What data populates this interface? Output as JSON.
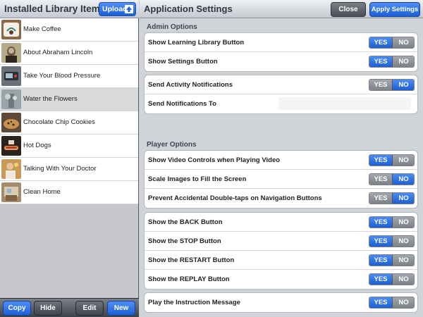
{
  "left_panel": {
    "title": "Installed Library Items",
    "upload_label": "Upload",
    "items": [
      {
        "label": "Make Coffee",
        "thumb": "coffee-thumbnail"
      },
      {
        "label": "About Abraham Lincoln",
        "thumb": "lincoln-portrait-thumbnail"
      },
      {
        "label": "Take Your Blood Pressure",
        "thumb": "blood-pressure-thumbnail"
      },
      {
        "label": "Water the Flowers",
        "thumb": "flowers-thumbnail",
        "selected": true
      },
      {
        "label": "Chocolate Chip Cookies",
        "thumb": "cookies-thumbnail"
      },
      {
        "label": "Hot Dogs",
        "thumb": "hot-dogs-thumbnail"
      },
      {
        "label": "Talking With Your Doctor",
        "thumb": "doctor-thumbnail"
      },
      {
        "label": "Clean Home",
        "thumb": "clean-home-thumbnail"
      }
    ],
    "footer": {
      "copy_label": "Copy",
      "hide_label": "Hide",
      "edit_label": "Edit",
      "new_label": "New"
    }
  },
  "right_panel": {
    "title": "Application Settings",
    "close_label": "Close",
    "apply_label": "Apply Settings",
    "admin_section_title": "Admin Options",
    "player_section_title": "Player Options",
    "yes_label": "YES",
    "no_label": "NO",
    "admin_group1": [
      {
        "label": "Show Learning Library Button",
        "value": "YES"
      },
      {
        "label": "Show Settings Button",
        "value": "YES"
      }
    ],
    "admin_group2": {
      "notifications_label": "Send Activity Notifications",
      "notifications_value": "NO",
      "send_to_label": "Send Notifications To",
      "send_to_value": ""
    },
    "player_group1": [
      {
        "label": "Show Video Controls when Playing Video",
        "value": "YES"
      },
      {
        "label": "Scale Images to Fill the Screen",
        "value": "NO"
      },
      {
        "label": "Prevent Accidental Double-taps on Navigation Buttons",
        "value": "NO"
      }
    ],
    "player_group2": [
      {
        "label": "Show the BACK Button",
        "value": "YES"
      },
      {
        "label": "Show the STOP Button",
        "value": "YES"
      },
      {
        "label": "Show the RESTART Button",
        "value": "YES"
      },
      {
        "label": "Show the REPLAY Button",
        "value": "YES"
      }
    ],
    "player_group3": [
      {
        "label": "Play the Instruction Message",
        "value": "YES"
      }
    ]
  },
  "colors": {
    "accent_blue": "#2a6ee6",
    "toggle_off": "#8e9399",
    "header_bg": "#d9dde2"
  }
}
